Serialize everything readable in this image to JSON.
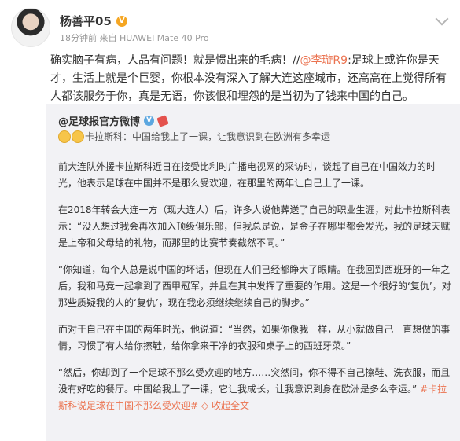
{
  "header": {
    "name": "杨善平05",
    "badge": "V",
    "meta": "18分钟前 来自 HUAWEI Mate 40 Pro"
  },
  "post": {
    "text_part1": "确实脑子有病，人品有问题！就是惯出来的毛病！//",
    "mention": "@李璇R9",
    "text_part2": ":足球上或许你是天才，生活上就是个巨婴，你根本没有深入了解大连这座城市，还高高在上觉得所有人都该服务于你，真是无语，你该恨和埋怨的是当初为了钱来中国的自己。"
  },
  "repost": {
    "author": "@足球报官方微博",
    "author_badge": "V",
    "title": "卡拉斯科：中国给我上了一课，让我意识到在欧洲有多幸运",
    "paragraphs": [
      "前大连队外援卡拉斯科近日在接受比利时广播电视网的采访时，谈起了自己在中国效力的时光，他表示足球在中国并不是那么受欢迎，在那里的两年让自己上了一课。",
      "在2018年转会大连一方（现大连人）后，许多人说他葬送了自己的职业生涯，对此卡拉斯科表示：“没人想过我会再次加入顶级俱乐部，但我总是说，是金子在哪里都会发光，我的足球天赋是上帝和父母给的礼物，而那里的比赛节奏截然不同。”",
      "“你知道，每个人总是说中国的坏话，但现在人们已经都睁大了眼睛。在我回到西班牙的一年之后，我和马竞一起拿到了西甲冠军，并且在其中发挥了重要的作用。这是一个很好的‘复仇’，对那些质疑我的人的‘复仇’，现在我必须继续继续自己的脚步。”",
      "而对于自己在中国的两年时光，他说道：“当然，如果你像我一样，从小就做自己一直想做的事情，习惯了有人给你擦鞋，给你拿来干净的衣服和桌子上的西班牙菜。”"
    ],
    "last_paragraph": "“然后，你却到了一个足球不那么受欢迎的地方……突然间，你不得不自己擦鞋、洗衣服，而且没有好吃的餐厅。中国给我上了一课，它让我成长，让我意识到身在欧洲是多么幸运。”",
    "topic": "#卡拉斯科说足球在中国不那么受欢迎#",
    "collapse": "收起全文",
    "collapse_arrow": "◇"
  }
}
